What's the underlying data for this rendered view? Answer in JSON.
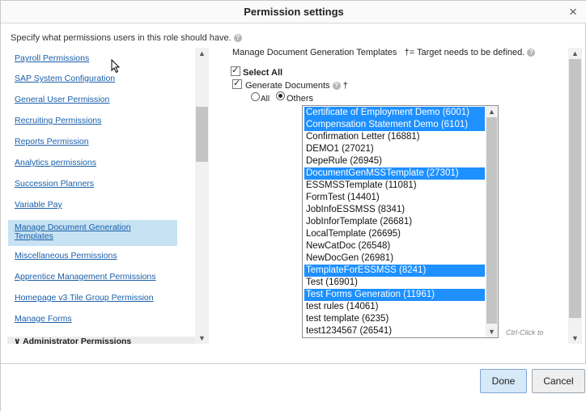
{
  "dialog": {
    "title": "Permission settings",
    "close_label": "×",
    "intro": "Specify what permissions users in this role should have.",
    "help_glyph": "?"
  },
  "nav": {
    "items": [
      {
        "label": "Payroll Permissions"
      },
      {
        "label": "SAP System Configuration"
      },
      {
        "label": "General User Permission"
      },
      {
        "label": "Recruiting Permissions"
      },
      {
        "label": "Reports Permission"
      },
      {
        "label": "Analytics permissions"
      },
      {
        "label": "Succession Planners"
      },
      {
        "label": "Variable Pay"
      },
      {
        "label": "Manage Document Generation Templates",
        "active": true
      },
      {
        "label": "Miscellaneous Permissions"
      },
      {
        "label": "Apprentice Management Permissions"
      },
      {
        "label": "Homepage v3 Tile Group Permission"
      },
      {
        "label": "Manage Forms"
      }
    ],
    "admin_header": "Administrator Permissions",
    "admin_glyph": "∨"
  },
  "section": {
    "title": "Manage Document Generation Templates",
    "target_note": "†= Target needs to be defined.",
    "select_all_label": "Select All",
    "select_all_checked": true,
    "generate_label": "Generate Documents",
    "generate_checked": true,
    "dagger": "†",
    "radio_all": "All",
    "radio_others": "Others",
    "selected_radio": "Others",
    "ctrl_hint": "Ctrl-Click to",
    "templates": [
      {
        "label": "Certificate of Employment Demo (6001)",
        "selected": true
      },
      {
        "label": "Compensation Statement Demo (6101)",
        "selected": true
      },
      {
        "label": "Confirmation Letter (16881)",
        "selected": false
      },
      {
        "label": "DEMO1 (27021)",
        "selected": false
      },
      {
        "label": "DepeRule (26945)",
        "selected": false
      },
      {
        "label": "DocumentGenMSSTemplate (27301)",
        "selected": true
      },
      {
        "label": "ESSMSSTemplate (11081)",
        "selected": false
      },
      {
        "label": "FormTest (14401)",
        "selected": false
      },
      {
        "label": "JobInfoESSMSS (8341)",
        "selected": false
      },
      {
        "label": "JobInforTemplate (26681)",
        "selected": false
      },
      {
        "label": "LocalTemplate (26695)",
        "selected": false
      },
      {
        "label": "NewCatDoc (26548)",
        "selected": false
      },
      {
        "label": "NewDocGen (26981)",
        "selected": false
      },
      {
        "label": "TemplateForESSMSS (8241)",
        "selected": true
      },
      {
        "label": "Test (16901)",
        "selected": false
      },
      {
        "label": "Test Forms Generation (11961)",
        "selected": true
      },
      {
        "label": "test rules (14061)",
        "selected": false
      },
      {
        "label": "test template (6235)",
        "selected": false
      },
      {
        "label": "test1234567 (26541)",
        "selected": false
      }
    ]
  },
  "footer": {
    "done_label": "Done",
    "cancel_label": "Cancel"
  },
  "colors": {
    "link": "#1a5fa8",
    "active_nav_bg": "#c7e2f3",
    "selected_option_bg": "#1e90ff"
  }
}
